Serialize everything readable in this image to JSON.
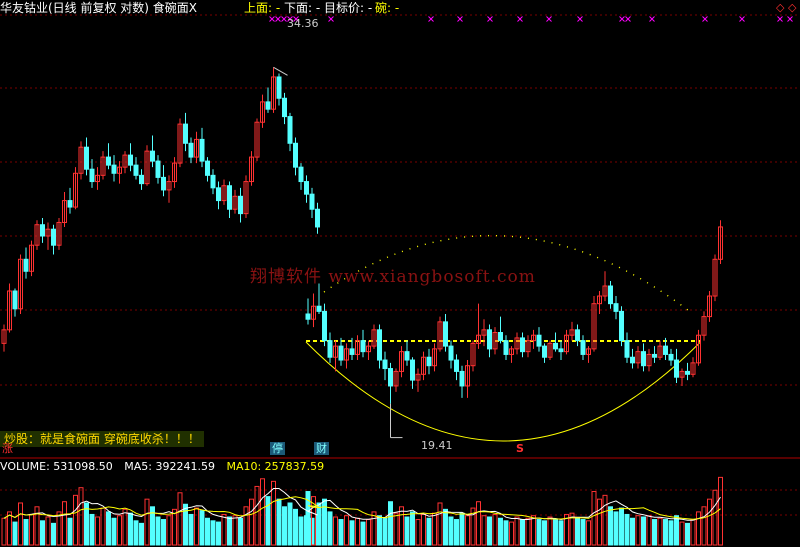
{
  "header": {
    "title": "华友钴业(日线 前复权 对数) 食碗面X",
    "upper_label": "上面: -",
    "lower_label": "下面: -",
    "target_label": "目标价: -",
    "bowl_label": "碗: -"
  },
  "price_labels": {
    "high": "34.36",
    "low": "19.41"
  },
  "watermark": "翔博软件 www.xiangbosoft.com",
  "banner": "炒股：就是食碗面   穿碗底收杀！！！",
  "markers": {
    "left": "涨",
    "ting": "停",
    "cai": "财",
    "s": "S"
  },
  "volume_header": {
    "volume": "VOLUME: 531098.50",
    "ma5": "MA5: 392241.59",
    "ma10": "MA10: 257837.59"
  },
  "top_right_icons": [
    "diamond-icon",
    "diamond-icon"
  ],
  "colors": {
    "background": "#000000",
    "up": "#ff3232",
    "down": "#54ffff",
    "ma5_line": "#ffffff",
    "ma10_line": "#ffff00",
    "bowl_curve": "#ffff00",
    "dashed_line": "#ffff00",
    "magenta_marks": "#ff00ff",
    "grid": "#7a0000"
  },
  "chart_data": [
    {
      "type": "candlestick",
      "title": "华友钴业(日线 前复权 对数) 食碗面X",
      "scale": "log",
      "y_range": [
        18,
        38
      ],
      "annotations": [
        {
          "label": "34.36",
          "kind": "high"
        },
        {
          "label": "19.41",
          "kind": "low"
        }
      ],
      "candles": [
        [
          21.5,
          22.2,
          21.2,
          22.0
        ],
        [
          22.0,
          23.8,
          21.9,
          23.5
        ],
        [
          23.5,
          23.6,
          22.5,
          22.8
        ],
        [
          22.8,
          25.0,
          22.6,
          24.8
        ],
        [
          24.8,
          25.3,
          24.0,
          24.3
        ],
        [
          24.3,
          25.6,
          24.1,
          25.4
        ],
        [
          25.4,
          26.5,
          25.2,
          26.3
        ],
        [
          26.3,
          26.6,
          25.5,
          25.8
        ],
        [
          25.8,
          26.4,
          25.2,
          26.1
        ],
        [
          26.1,
          26.3,
          25.0,
          25.4
        ],
        [
          25.4,
          26.6,
          25.2,
          26.4
        ],
        [
          26.4,
          27.8,
          26.2,
          27.4
        ],
        [
          27.4,
          28.0,
          26.8,
          27.1
        ],
        [
          27.1,
          29.0,
          27.0,
          28.7
        ],
        [
          28.7,
          30.3,
          28.4,
          30.0
        ],
        [
          30.0,
          30.5,
          28.6,
          28.9
        ],
        [
          28.9,
          29.4,
          28.0,
          28.3
        ],
        [
          28.3,
          29.0,
          27.9,
          28.6
        ],
        [
          28.6,
          29.8,
          28.4,
          29.5
        ],
        [
          29.5,
          30.2,
          28.9,
          29.1
        ],
        [
          29.1,
          29.6,
          28.3,
          28.7
        ],
        [
          28.7,
          29.3,
          28.2,
          29.0
        ],
        [
          29.0,
          29.8,
          28.7,
          29.6
        ],
        [
          29.6,
          30.2,
          28.8,
          29.1
        ],
        [
          29.1,
          29.5,
          28.4,
          28.6
        ],
        [
          28.6,
          28.9,
          27.9,
          28.2
        ],
        [
          28.2,
          30.1,
          28.1,
          29.8
        ],
        [
          29.8,
          30.6,
          29.0,
          29.3
        ],
        [
          29.3,
          29.6,
          28.2,
          28.5
        ],
        [
          28.5,
          29.1,
          27.6,
          27.9
        ],
        [
          27.9,
          28.6,
          27.3,
          28.3
        ],
        [
          28.3,
          29.5,
          28.0,
          29.2
        ],
        [
          29.2,
          31.5,
          29.0,
          31.2
        ],
        [
          31.2,
          31.8,
          29.8,
          30.2
        ],
        [
          30.2,
          30.5,
          29.2,
          29.5
        ],
        [
          29.5,
          30.8,
          29.2,
          30.4
        ],
        [
          30.4,
          31.0,
          29.0,
          29.3
        ],
        [
          29.3,
          29.5,
          28.3,
          28.6
        ],
        [
          28.6,
          28.9,
          27.7,
          28.0
        ],
        [
          28.0,
          28.3,
          27.0,
          27.4
        ],
        [
          27.4,
          28.4,
          27.2,
          28.1
        ],
        [
          28.1,
          28.3,
          26.6,
          27.0
        ],
        [
          27.0,
          27.9,
          26.8,
          27.6
        ],
        [
          27.6,
          28.0,
          26.4,
          26.8
        ],
        [
          26.8,
          28.6,
          26.6,
          28.3
        ],
        [
          28.3,
          29.8,
          28.1,
          29.5
        ],
        [
          29.5,
          31.5,
          29.3,
          31.3
        ],
        [
          31.3,
          32.8,
          31.0,
          32.4
        ],
        [
          32.4,
          33.2,
          31.8,
          32.0
        ],
        [
          32.0,
          34.36,
          31.8,
          33.8
        ],
        [
          33.8,
          34.0,
          32.2,
          32.6
        ],
        [
          32.6,
          32.9,
          31.2,
          31.6
        ],
        [
          31.6,
          31.8,
          29.8,
          30.2
        ],
        [
          30.2,
          30.5,
          28.6,
          29.0
        ],
        [
          29.0,
          29.2,
          27.9,
          28.3
        ],
        [
          28.3,
          28.6,
          27.3,
          27.7
        ],
        [
          27.7,
          28.0,
          26.6,
          27.0
        ],
        [
          27.0,
          27.3,
          25.9,
          26.2
        ],
        [
          22.6,
          23.2,
          22.2,
          22.4
        ],
        [
          22.4,
          23.4,
          22.1,
          22.9
        ],
        [
          22.9,
          23.8,
          22.6,
          22.7
        ],
        [
          22.7,
          23.0,
          21.4,
          21.6
        ],
        [
          21.6,
          21.9,
          20.8,
          21.0
        ],
        [
          21.0,
          21.6,
          20.5,
          21.4
        ],
        [
          21.4,
          21.7,
          20.7,
          20.9
        ],
        [
          20.9,
          21.5,
          20.6,
          21.3
        ],
        [
          21.3,
          21.7,
          20.9,
          21.1
        ],
        [
          21.1,
          21.8,
          20.9,
          21.6
        ],
        [
          21.6,
          22.0,
          21.0,
          21.2
        ],
        [
          21.2,
          21.6,
          20.9,
          21.4
        ],
        [
          21.4,
          22.2,
          21.3,
          22.0
        ],
        [
          22.0,
          22.2,
          20.6,
          20.9
        ],
        [
          20.9,
          21.2,
          20.2,
          20.6
        ],
        [
          20.6,
          20.8,
          19.41,
          20.0
        ],
        [
          20.0,
          20.6,
          19.8,
          20.5
        ],
        [
          20.5,
          21.4,
          20.3,
          21.2
        ],
        [
          21.2,
          21.6,
          20.7,
          20.9
        ],
        [
          20.9,
          21.0,
          19.9,
          20.2
        ],
        [
          20.2,
          20.6,
          19.8,
          20.4
        ],
        [
          20.4,
          21.2,
          20.2,
          21.0
        ],
        [
          21.0,
          21.3,
          20.4,
          20.7
        ],
        [
          20.7,
          21.5,
          20.5,
          21.3
        ],
        [
          21.3,
          22.5,
          21.2,
          22.3
        ],
        [
          22.3,
          22.6,
          21.2,
          21.4
        ],
        [
          21.4,
          21.6,
          20.6,
          20.9
        ],
        [
          20.9,
          21.1,
          20.2,
          20.5
        ],
        [
          20.5,
          20.7,
          19.6,
          20.0
        ],
        [
          20.0,
          20.9,
          19.6,
          20.7
        ],
        [
          20.7,
          21.6,
          20.5,
          21.5
        ],
        [
          21.5,
          23.0,
          21.3,
          21.8
        ],
        [
          21.8,
          22.4,
          21.4,
          22.0
        ],
        [
          22.0,
          22.2,
          21.0,
          21.3
        ],
        [
          21.3,
          22.1,
          21.1,
          21.9
        ],
        [
          21.9,
          22.5,
          21.5,
          21.6
        ],
        [
          21.6,
          21.8,
          20.9,
          21.1
        ],
        [
          21.1,
          21.4,
          20.8,
          21.3
        ],
        [
          21.3,
          21.9,
          21.1,
          21.7
        ],
        [
          21.7,
          21.9,
          21.0,
          21.2
        ],
        [
          21.2,
          21.8,
          21.0,
          21.6
        ],
        [
          21.6,
          22.0,
          21.3,
          21.8
        ],
        [
          21.8,
          22.1,
          21.2,
          21.4
        ],
        [
          21.4,
          21.5,
          20.8,
          21.0
        ],
        [
          21.0,
          21.6,
          20.9,
          21.5
        ],
        [
          21.5,
          21.9,
          21.2,
          21.3
        ],
        [
          21.3,
          21.6,
          20.9,
          21.2
        ],
        [
          21.2,
          22.0,
          21.1,
          21.8
        ],
        [
          21.8,
          22.3,
          21.6,
          22.0
        ],
        [
          22.0,
          22.2,
          21.4,
          21.6
        ],
        [
          21.6,
          21.8,
          20.9,
          21.1
        ],
        [
          21.1,
          21.4,
          20.8,
          21.3
        ],
        [
          21.3,
          23.3,
          21.2,
          23.0
        ],
        [
          23.0,
          23.5,
          22.6,
          23.3
        ],
        [
          23.3,
          24.3,
          23.1,
          23.7
        ],
        [
          23.7,
          23.9,
          22.8,
          23.0
        ],
        [
          23.0,
          23.3,
          22.4,
          22.7
        ],
        [
          22.7,
          22.9,
          21.4,
          21.6
        ],
        [
          21.6,
          21.9,
          20.8,
          21.0
        ],
        [
          21.0,
          21.3,
          20.6,
          20.8
        ],
        [
          20.8,
          21.4,
          20.6,
          21.2
        ],
        [
          21.2,
          21.5,
          20.5,
          20.7
        ],
        [
          20.7,
          21.3,
          20.5,
          21.1
        ],
        [
          21.1,
          21.4,
          20.8,
          21.0
        ],
        [
          21.0,
          21.6,
          20.9,
          21.4
        ],
        [
          21.4,
          21.7,
          20.9,
          21.1
        ],
        [
          21.1,
          21.3,
          20.7,
          20.9
        ],
        [
          20.9,
          21.3,
          20.1,
          20.3
        ],
        [
          20.3,
          20.6,
          20.0,
          20.5
        ],
        [
          20.5,
          20.8,
          20.2,
          20.4
        ],
        [
          20.4,
          21.0,
          20.3,
          20.8
        ],
        [
          20.8,
          22.0,
          20.7,
          21.8
        ],
        [
          21.8,
          22.7,
          21.6,
          22.5
        ],
        [
          22.5,
          23.5,
          22.3,
          23.3
        ],
        [
          23.3,
          25.0,
          23.1,
          24.8
        ],
        [
          24.8,
          26.5,
          24.6,
          26.2
        ]
      ]
    },
    {
      "type": "bar",
      "title": "VOLUME",
      "series": [
        {
          "name": "VOLUME",
          "values": [
            210000,
            260000,
            180000,
            330000,
            200000,
            240000,
            300000,
            190000,
            220000,
            170000,
            260000,
            340000,
            210000,
            390000,
            450000,
            330000,
            240000,
            220000,
            290000,
            260000,
            210000,
            230000,
            280000,
            250000,
            190000,
            170000,
            360000,
            300000,
            220000,
            200000,
            230000,
            280000,
            410000,
            320000,
            240000,
            290000,
            270000,
            210000,
            190000,
            180000,
            240000,
            220000,
            230000,
            210000,
            300000,
            360000,
            460000,
            520000,
            380000,
            500000,
            360000,
            300000,
            330000,
            280000,
            220000,
            230000,
            210000,
            240000,
            420000,
            380000,
            330000,
            360000,
            260000,
            220000,
            200000,
            230000,
            190000,
            210000,
            180000,
            200000,
            260000,
            230000,
            210000,
            340000,
            250000,
            300000,
            220000,
            260000,
            200000,
            240000,
            210000,
            250000,
            330000,
            280000,
            220000,
            200000,
            250000,
            230000,
            290000,
            340000,
            230000,
            220000,
            240000,
            210000,
            190000,
            180000,
            220000,
            200000,
            210000,
            230000,
            200000,
            190000,
            220000,
            200000,
            190000,
            240000,
            250000,
            210000,
            200000,
            190000,
            420000,
            360000,
            390000,
            300000,
            260000,
            290000,
            240000,
            210000,
            230000,
            220000,
            230000,
            200000,
            210000,
            200000,
            190000,
            230000,
            180000,
            170000,
            200000,
            260000,
            300000,
            360000,
            430000,
            531098.5
          ]
        },
        {
          "name": "MA5",
          "last": 392241.59
        },
        {
          "name": "MA10",
          "last": 257837.59
        }
      ]
    }
  ]
}
